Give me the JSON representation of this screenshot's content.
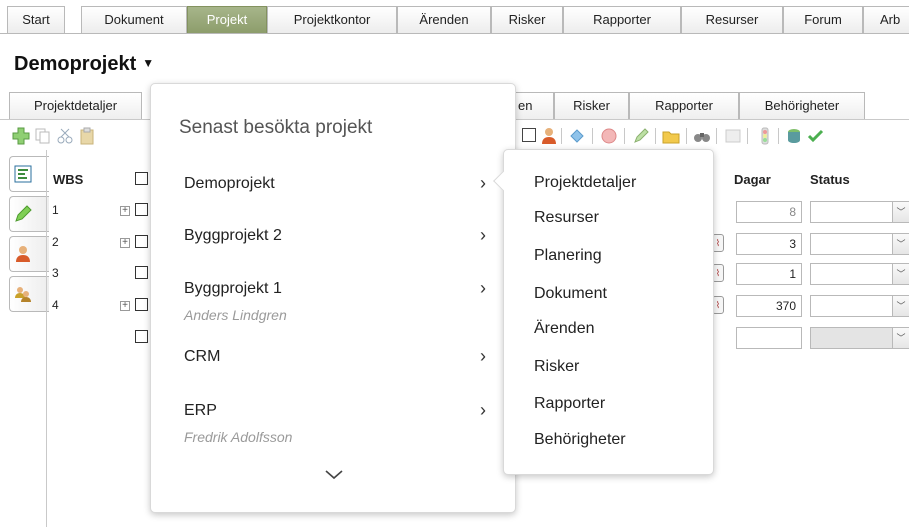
{
  "top_tabs": [
    "Start",
    "Dokument",
    "Projekt",
    "Projektkontor",
    "Ärenden",
    "Risker",
    "Rapporter",
    "Resurser",
    "Forum",
    "Arb"
  ],
  "active_top_tab": "Projekt",
  "page_title": "Demoprojekt",
  "sub_tabs": [
    "Projektdetaljer",
    "en",
    "Risker",
    "Rapporter",
    "Behörigheter"
  ],
  "grid": {
    "wbs_header": "WBS",
    "dagar_header": "Dagar",
    "status_header": "Status",
    "rows": [
      {
        "num": "1",
        "dagar": "8"
      },
      {
        "num": "2",
        "dagar": "3"
      },
      {
        "num": "3",
        "dagar": "1"
      },
      {
        "num": "4",
        "dagar": "370"
      },
      {
        "num": "",
        "dagar": ""
      }
    ]
  },
  "recent_popup": {
    "title": "Senast besökta projekt",
    "projects": [
      {
        "name": "Demoprojekt",
        "owner": ""
      },
      {
        "name": "Byggprojekt 2",
        "owner": ""
      },
      {
        "name": "Byggprojekt 1",
        "owner": "Anders Lindgren"
      },
      {
        "name": "CRM",
        "owner": ""
      },
      {
        "name": "ERP",
        "owner": "Fredrik Adolfsson"
      }
    ]
  },
  "submenu": {
    "items": [
      "Projektdetaljer",
      "Resurser",
      "Planering",
      "Dokument",
      "Ärenden",
      "Risker",
      "Rapporter",
      "Behörigheter"
    ]
  },
  "colors": {
    "active_tab": "#98a77a",
    "tab_border": "#b9b9b9",
    "owner_text": "#9a9a9a"
  },
  "icons": {
    "title_caret": "caret-down-icon",
    "submenu_chevron": "chevron-right-icon",
    "more": "chevron-down-icon"
  }
}
